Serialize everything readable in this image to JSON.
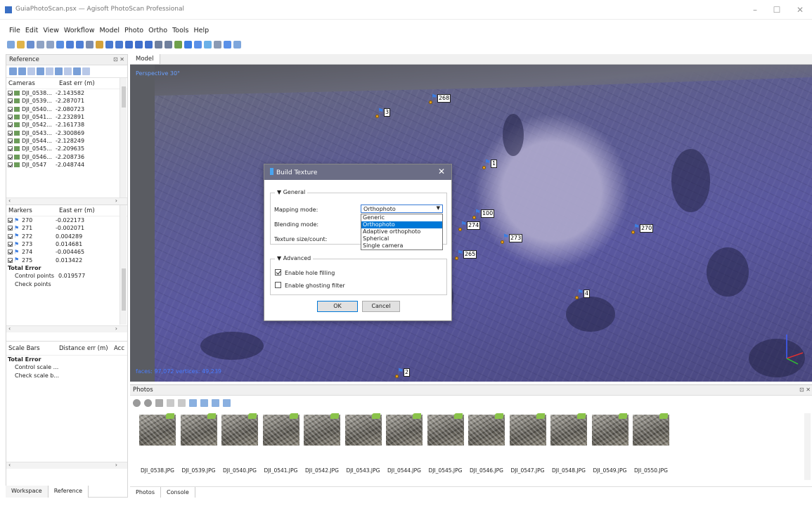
{
  "window": {
    "title": "GuiaPhotoScan.psx — Agisoft PhotoScan Professional"
  },
  "menu": [
    "File",
    "Edit",
    "View",
    "Workflow",
    "Model",
    "Photo",
    "Ortho",
    "Tools",
    "Help"
  ],
  "reference_panel": {
    "title": "Reference",
    "cameras": {
      "col1": "Cameras",
      "col2": "East err (m)",
      "rows": [
        {
          "name": "DJI_0538...",
          "value": "-2.143582"
        },
        {
          "name": "DJI_0539...",
          "value": "-2.287071"
        },
        {
          "name": "DJI_0540...",
          "value": "-2.080723"
        },
        {
          "name": "DJI_0541...",
          "value": "-2.232891"
        },
        {
          "name": "DJI_0542...",
          "value": "-2.161738"
        },
        {
          "name": "DJI_0543...",
          "value": "-2.300869"
        },
        {
          "name": "DJI_0544...",
          "value": "-2.128249"
        },
        {
          "name": "DJI_0545...",
          "value": "-2.209635"
        },
        {
          "name": "DJI_0546...",
          "value": "-2.208736"
        },
        {
          "name": "DJI_0547",
          "value": "-2.048744"
        }
      ]
    },
    "markers": {
      "col1": "Markers",
      "col2": "East err (m)",
      "rows": [
        {
          "name": "270",
          "value": "-0.022173"
        },
        {
          "name": "271",
          "value": "-0.002071"
        },
        {
          "name": "272",
          "value": "0.004289"
        },
        {
          "name": "273",
          "value": "0.014681"
        },
        {
          "name": "274",
          "value": "-0.004465"
        },
        {
          "name": "275",
          "value": "0.013422"
        }
      ],
      "total_error": "Total Error",
      "control_points": "Control points",
      "control_points_value": "0.019577",
      "check_points": "Check points"
    },
    "scale_bars": {
      "col1": "Scale Bars",
      "col2": "Distance err (m)",
      "col3": "Acc",
      "total_error": "Total Error",
      "control_scale": "Control scale ...",
      "check_scale": "Check scale b..."
    },
    "tabs": [
      "Workspace",
      "Reference"
    ]
  },
  "model_view": {
    "tab": "Model",
    "perspective": "Perspective 30°",
    "faces_info": "faces: 97,072 vertices: 49,239",
    "markers": [
      "268",
      "3",
      "1",
      "100",
      "274",
      "273",
      "270",
      "265",
      "4",
      "2"
    ]
  },
  "dialog": {
    "title": "Build Texture",
    "general": "General",
    "mapping_mode_label": "Mapping mode:",
    "mapping_mode_value": "Orthophoto",
    "blending_mode_label": "Blending mode:",
    "texture_size_label": "Texture size/count:",
    "mapping_options": [
      "Generic",
      "Orthophoto",
      "Adaptive orthophoto",
      "Spherical",
      "Single camera"
    ],
    "advanced": "Advanced",
    "hole_filling": "Enable hole filling",
    "ghosting_filter": "Enable ghosting filter",
    "ok": "OK",
    "cancel": "Cancel"
  },
  "photos_pane": {
    "title": "Photos",
    "photos": [
      "DJI_0538.JPG",
      "DJI_0539.JPG",
      "DJI_0540.JPG",
      "DJI_0541.JPG",
      "DJI_0542.JPG",
      "DJI_0543.JPG",
      "DJI_0544.JPG",
      "DJI_0545.JPG",
      "DJI_0546.JPG",
      "DJI_0547.JPG",
      "DJI_0548.JPG",
      "DJI_0549.JPG",
      "DJI_0550.JPG"
    ],
    "tabs": [
      "Photos",
      "Console"
    ]
  }
}
